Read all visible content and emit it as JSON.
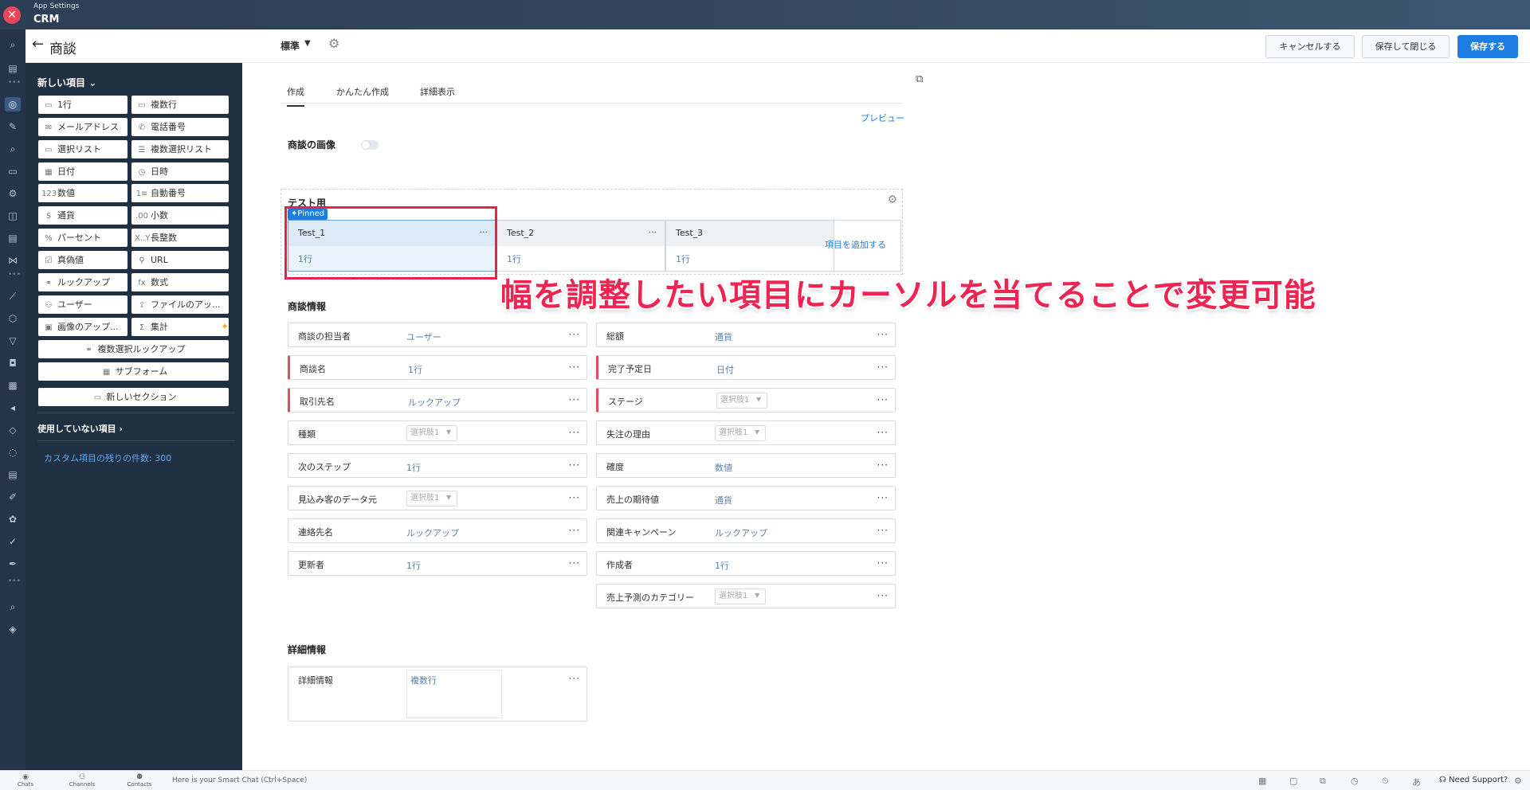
{
  "app": {
    "subtitle": "App Settings",
    "title": "CRM"
  },
  "header": {
    "page_title": "商談",
    "layout_name": "標準",
    "cancel_label": "キャンセルする",
    "save_close_label": "保存して閉じる",
    "save_label": "保存する"
  },
  "palette": {
    "new_items_label": "新しい項目",
    "items": [
      {
        "icon": "▭",
        "label": "1行"
      },
      {
        "icon": "▭",
        "label": "複数行"
      },
      {
        "icon": "✉",
        "label": "メールアドレス"
      },
      {
        "icon": "✆",
        "label": "電話番号"
      },
      {
        "icon": "▭",
        "label": "選択リスト"
      },
      {
        "icon": "☰",
        "label": "複数選択リスト"
      },
      {
        "icon": "▦",
        "label": "日付"
      },
      {
        "icon": "◷",
        "label": "日時"
      },
      {
        "icon": "123",
        "label": "数値"
      },
      {
        "icon": "1≡",
        "label": "自動番号"
      },
      {
        "icon": "$",
        "label": "通貨"
      },
      {
        "icon": ".00",
        "label": "小数"
      },
      {
        "icon": "%",
        "label": "パーセント"
      },
      {
        "icon": "X..Y",
        "label": "長整数"
      },
      {
        "icon": "☑",
        "label": "真偽値"
      },
      {
        "icon": "⚲",
        "label": "URL"
      },
      {
        "icon": "⚭",
        "label": "ルックアップ"
      },
      {
        "icon": "fx",
        "label": "数式"
      },
      {
        "icon": "⚇",
        "label": "ユーザー"
      },
      {
        "icon": "⇪",
        "label": "ファイルのアッ..."
      },
      {
        "icon": "▣",
        "label": "画像のアップ..."
      },
      {
        "icon": "Σ",
        "label": "集計"
      }
    ],
    "multi_lookup_label": "複数選択ルックアップ",
    "subform_label": "サブフォーム",
    "new_section_label": "新しいセクション",
    "unused_label": "使用していない項目",
    "remaining_label": "カスタム項目の残りの件数: 300"
  },
  "tabs": [
    "作成",
    "かんたん作成",
    "詳細表示"
  ],
  "preview_label": "プレビュー",
  "image_section_label": "商談の画像",
  "test_section": {
    "title": "テスト用",
    "pinned_label": "Pinned",
    "columns": [
      {
        "name": "Test_1",
        "type": "1行"
      },
      {
        "name": "Test_2",
        "type": "1行"
      },
      {
        "name": "Test_3",
        "type": "1行"
      }
    ],
    "add_item_label": "項目を追加する"
  },
  "callout": "幅を調整したい項目にカーソルを当てることで変更可能",
  "deal_info": {
    "title": "商談情報",
    "left": [
      {
        "label": "商談の担当者",
        "type": "ユーザー",
        "kind": "text",
        "required": false
      },
      {
        "label": "商談名",
        "type": "1行",
        "kind": "text",
        "required": true
      },
      {
        "label": "取引先名",
        "type": "ルックアップ",
        "kind": "text",
        "required": true
      },
      {
        "label": "種類",
        "type": "選択肢1",
        "kind": "select",
        "required": false
      },
      {
        "label": "次のステップ",
        "type": "1行",
        "kind": "text",
        "required": false
      },
      {
        "label": "見込み客のデータ元",
        "type": "選択肢1",
        "kind": "select",
        "required": false
      },
      {
        "label": "連絡先名",
        "type": "ルックアップ",
        "kind": "text",
        "required": false
      },
      {
        "label": "更新者",
        "type": "1行",
        "kind": "text",
        "required": false
      }
    ],
    "right": [
      {
        "label": "総額",
        "type": "通貨",
        "kind": "text",
        "required": false
      },
      {
        "label": "完了予定日",
        "type": "日付",
        "kind": "text",
        "required": true
      },
      {
        "label": "ステージ",
        "type": "選択肢1",
        "kind": "select",
        "required": true
      },
      {
        "label": "失注の理由",
        "type": "選択肢1",
        "kind": "select",
        "required": false
      },
      {
        "label": "確度",
        "type": "数値",
        "kind": "text",
        "required": false
      },
      {
        "label": "売上の期待値",
        "type": "通貨",
        "kind": "text",
        "required": false
      },
      {
        "label": "関連キャンペーン",
        "type": "ルックアップ",
        "kind": "text",
        "required": false
      },
      {
        "label": "作成者",
        "type": "1行",
        "kind": "text",
        "required": false
      },
      {
        "label": "売上予測のカテゴリー",
        "type": "選択肢1",
        "kind": "select",
        "required": false
      }
    ]
  },
  "detail_info": {
    "title": "詳細情報",
    "field_label": "詳細情報",
    "field_type": "複数行"
  },
  "bottombar": {
    "chats": "Chats",
    "channels": "Channels",
    "contacts": "Contacts",
    "smart_chat": "Here is your Smart Chat (Ctrl+Space)",
    "support": "Need Support?"
  },
  "colors": {
    "accent": "#1e7de0",
    "highlight": "#e8224e",
    "sidebar": "#203043"
  }
}
